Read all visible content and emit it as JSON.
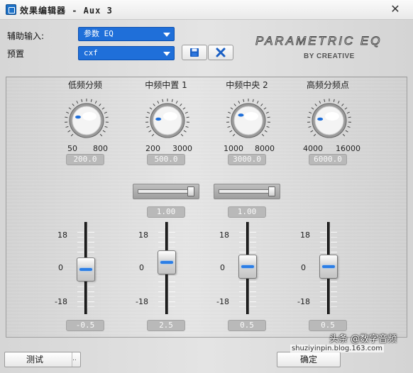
{
  "window": {
    "title": "效果编辑器 - Aux 3",
    "close_glyph": "✕"
  },
  "aux_input": {
    "label": "辅助输入:",
    "value": "参数 EQ"
  },
  "preset": {
    "label": "预置",
    "value": "cxf"
  },
  "icons": {
    "save": "floppy-disk-icon",
    "delete": "x-icon"
  },
  "brand": {
    "main": "PARAMETRIC EQ",
    "sub": "BY CREATIVE"
  },
  "bands": [
    {
      "title": "低频分频",
      "min": "50",
      "max": "800",
      "value": "200.0",
      "knob_level": 0.25,
      "q": null,
      "gain_label_top": "18",
      "gain_label_mid": "0",
      "gain_label_bot": "-18",
      "gain": "-0.5"
    },
    {
      "title": "中频中置 1",
      "min": "200",
      "max": "3000",
      "value": "500.0",
      "knob_level": 0.2,
      "q": "1.00",
      "q_level": 0.95,
      "gain_label_top": "18",
      "gain_label_mid": "0",
      "gain_label_bot": "-18",
      "gain": "2.5"
    },
    {
      "title": "中频中央 2",
      "min": "1000",
      "max": "8000",
      "value": "3000.0",
      "knob_level": 0.3,
      "q": "1.00",
      "q_level": 0.95,
      "gain_label_top": "18",
      "gain_label_mid": "0",
      "gain_label_bot": "-18",
      "gain": "0.5"
    },
    {
      "title": "高频分频点",
      "min": "4000",
      "max": "16000",
      "value": "6000.0",
      "knob_level": 0.2,
      "q": null,
      "gain_label_top": "18",
      "gain_label_mid": "0",
      "gain_label_bot": "-18",
      "gain": "0.5"
    }
  ],
  "footer": {
    "test_label": "测试",
    "test_arrow": "..",
    "ok_label": "确定",
    "watermark": "头条 @数字音频",
    "url": "shuziyinpin.blog.163.com"
  },
  "colors": {
    "accent": "#1f6fd9",
    "fader_led": "#2b7ee6"
  }
}
